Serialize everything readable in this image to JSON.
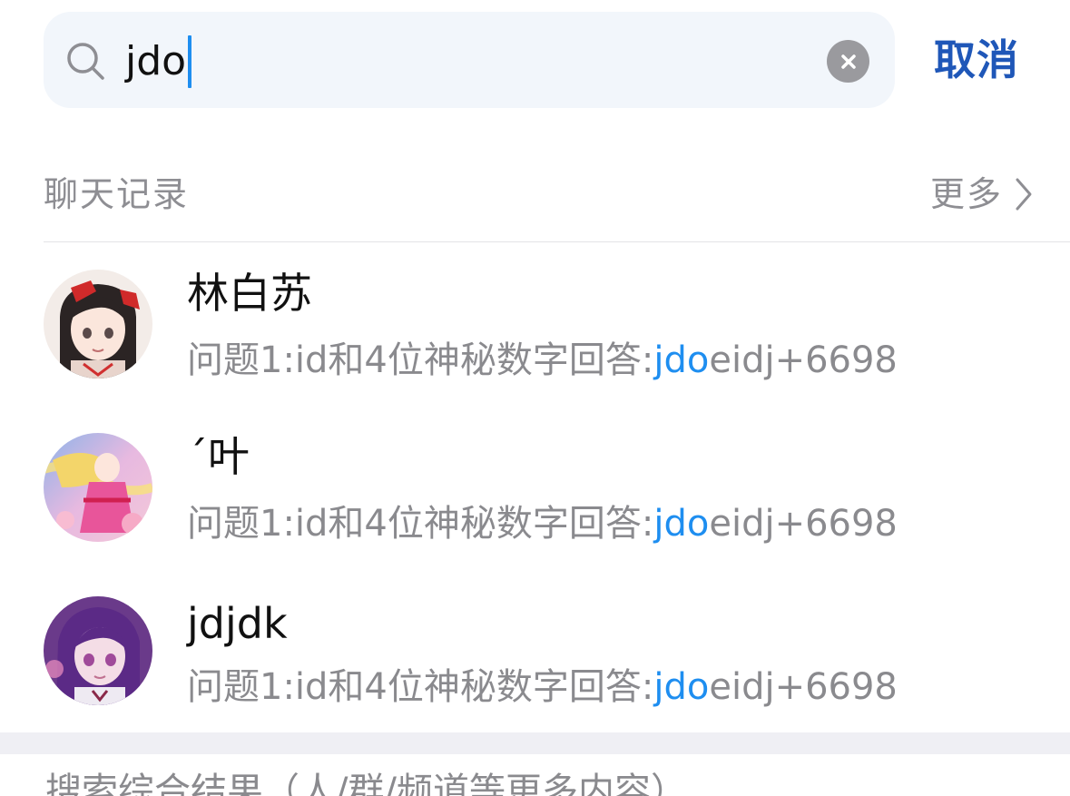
{
  "search": {
    "query": "jdo",
    "cancel_label": "取消"
  },
  "section": {
    "title": "聊天记录",
    "more_label": "更多"
  },
  "results": [
    {
      "name": "林白苏",
      "snippet_prefix": "问题1:id和4位神秘数字回答:",
      "snippet_match": "jdo",
      "snippet_suffix": "eidj+6698",
      "avatar": "anime-girl-red-bow-avatar"
    },
    {
      "name": "´叶",
      "snippet_prefix": "问题1:id和4位神秘数字回答:",
      "snippet_match": "jdo",
      "snippet_suffix": "eidj+6698",
      "avatar": "anime-girl-blonde-pink-avatar"
    },
    {
      "name": "jdjdk",
      "snippet_prefix": "问题1:id和4位神秘数字回答:",
      "snippet_match": "jdo",
      "snippet_suffix": "eidj+6698",
      "avatar": "anime-girl-purple-hair-avatar"
    }
  ],
  "bottom": {
    "text": "搜索综合结果（人/群/频道等更多内容）"
  },
  "colors": {
    "accent": "#1e8ef0",
    "cancel": "#1f57b8",
    "secondary_text": "#8e8e93",
    "search_bg": "#f2f6fb",
    "band": "#efeff4"
  }
}
